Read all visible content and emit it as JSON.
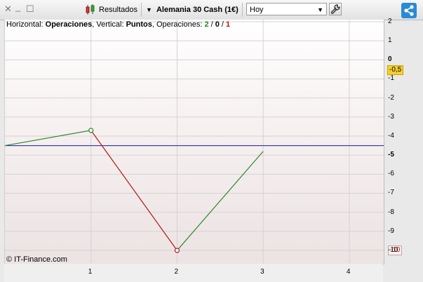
{
  "toolbar": {
    "close_glyph": "✕",
    "minimize_glyph": "_",
    "maximize_glyph": "☐",
    "results_label": "Resultados",
    "instrument_label": "Alemania 30 Cash (1€)",
    "period_select": {
      "value": "Hoy"
    }
  },
  "chart_header": {
    "horizontal_prefix": "Horizontal: ",
    "horizontal_value": "Operaciones",
    "vertical_prefix": ", Vertical: ",
    "vertical_value": "Puntos",
    "ops_prefix": ", Operaciones: ",
    "ops_won": "2",
    "ops_sep1": " / ",
    "ops_even": "0",
    "ops_sep2": " / ",
    "ops_lost": "1"
  },
  "copyright": "© IT-Finance.com",
  "current_value_badge": "-0,5",
  "min_value_badge": "-10",
  "colors": {
    "gain": "#2a8a2a",
    "loss": "#b01818",
    "reference": "#1a1aa8",
    "grid": "#d8d2d2"
  },
  "chart_data": {
    "type": "line",
    "x": [
      0,
      1,
      2,
      3
    ],
    "y": [
      -4.5,
      -3.7,
      -10.0,
      -4.8
    ],
    "segment_colors": [
      "gain",
      "loss",
      "gain"
    ],
    "reference_line": -4.5,
    "xlim": [
      0,
      4.4
    ],
    "ylim": [
      -10.7,
      2
    ],
    "x_ticks": [
      "1",
      "2",
      "3",
      "4"
    ],
    "y_ticks": [
      "2",
      "1",
      "0",
      "-1",
      "-2",
      "-3",
      "-4",
      "-5",
      "-6",
      "-7",
      "-8",
      "-9",
      "-10"
    ],
    "y_ticks_bold": [
      "0",
      "-5"
    ],
    "grid": true
  }
}
